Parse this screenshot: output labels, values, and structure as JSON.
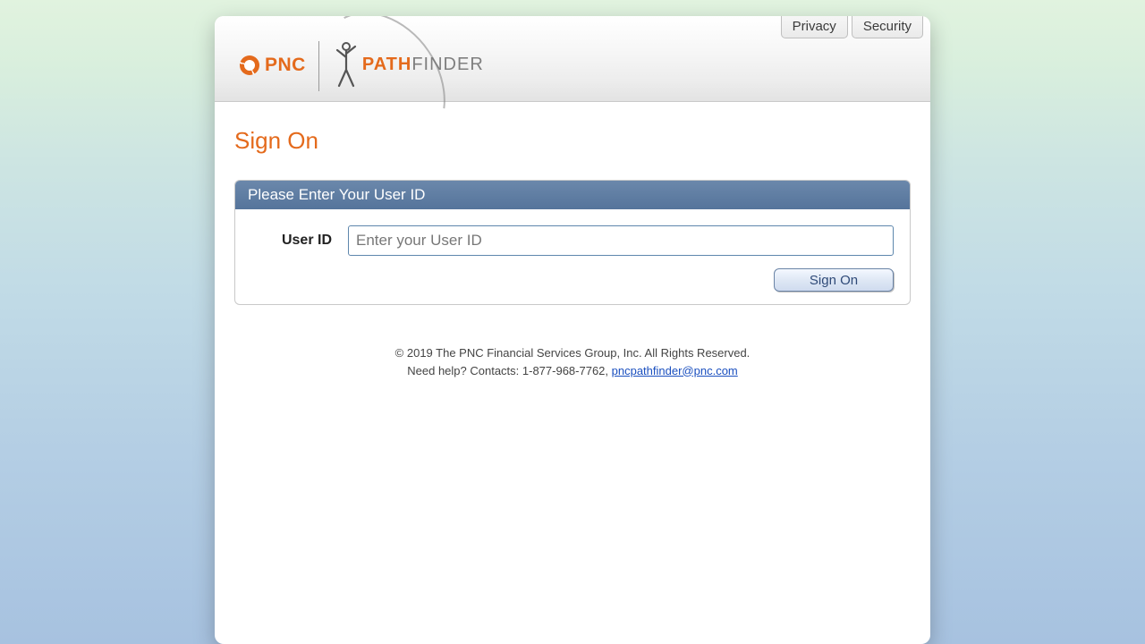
{
  "header": {
    "links": {
      "privacy": "Privacy",
      "security": "Security"
    },
    "logo": {
      "pnc": "PNC",
      "path": "PATH",
      "finder": "FINDER"
    }
  },
  "page": {
    "title": "Sign On"
  },
  "panel": {
    "title": "Please Enter Your User ID",
    "userIdLabel": "User ID",
    "userIdPlaceholder": "Enter your User ID",
    "signOnButton": "Sign On"
  },
  "footer": {
    "copyright": "© 2019 The PNC Financial Services Group, Inc. All Rights Reserved.",
    "helpPrefix": "Need help? Contacts: 1-877-968-7762, ",
    "email": "pncpathfinder@pnc.com"
  }
}
